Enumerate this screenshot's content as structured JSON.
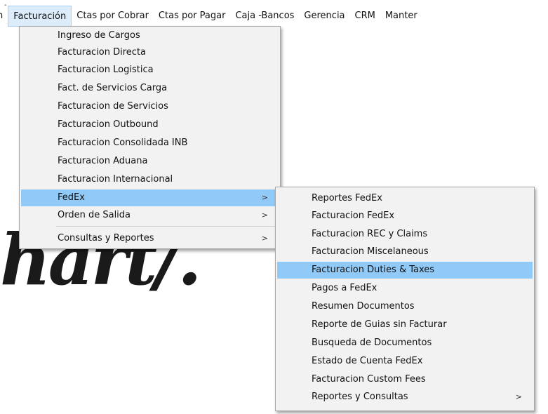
{
  "menubar": {
    "items": [
      "n",
      "Facturación",
      "Ctas por Cobrar",
      "Ctas por Pagar",
      "Caja -Bancos",
      "Gerencia",
      "CRM",
      "Manter"
    ]
  },
  "background_text": "hart/.",
  "facturacion_menu": {
    "items": [
      "Ingreso de Cargos",
      "Facturacion Directa",
      "Facturacion Logistica",
      "Fact. de Servicios Carga",
      "Facturacion de Servicios",
      "Facturacion Outbound",
      "Facturacion Consolidada INB",
      "Facturacion Aduana",
      "Facturacion Internacional",
      "FedEx",
      "Orden de Salida",
      "Consultas y Reportes"
    ],
    "submenu_arrow": ">"
  },
  "fedex_submenu": {
    "items": [
      "Reportes FedEx",
      "Facturacion FedEx",
      "Facturacion REC y Claims",
      "Facturacion Miscelaneous",
      "Facturacion Duties & Taxes",
      "Pagos a FedEx",
      "Resumen Documentos",
      "Reporte de Guias sin Facturar",
      "Busqueda de Documentos",
      "Estado de Cuenta FedEx",
      "Facturacion Custom Fees",
      "Reportes y Consultas"
    ],
    "submenu_arrow": ">"
  },
  "colors": {
    "selected_bg": "#91c9f7",
    "menu_bg": "#f2f2f2",
    "active_top_bg": "#dcecfb"
  }
}
